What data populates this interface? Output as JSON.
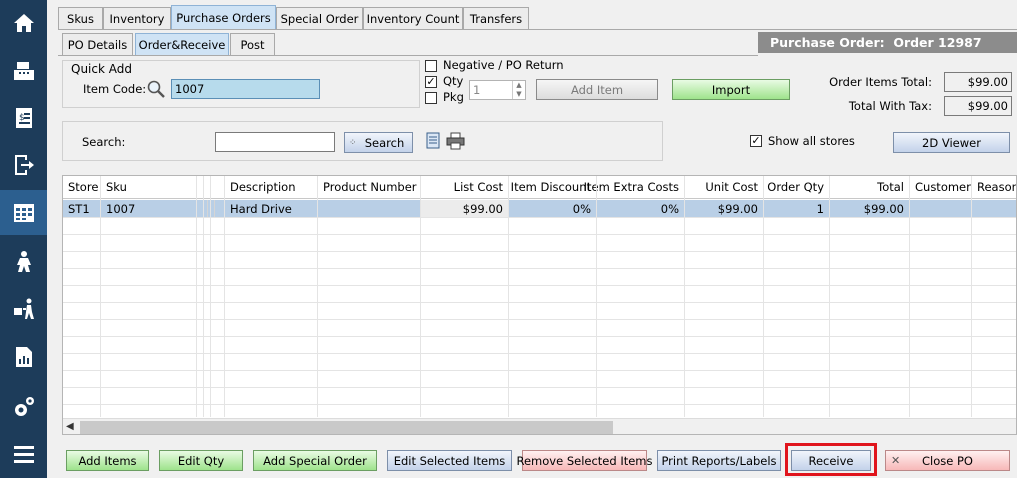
{
  "nav": {
    "icons": [
      "home-icon",
      "register-icon",
      "receipt-icon",
      "exit-icon",
      "inventory-icon",
      "customer-icon",
      "delivery-icon",
      "reports-icon",
      "settings-icon",
      "menu-icon"
    ]
  },
  "tabs": [
    "Skus",
    "Inventory",
    "Purchase Orders",
    "Special Order",
    "Inventory Count",
    "Transfers"
  ],
  "subtabs": [
    "PO Details",
    "Order&Receive",
    "Post"
  ],
  "po_header": "Purchase Order:  Order 12987",
  "quick_add": {
    "title": "Quick Add",
    "item_code_label": "Item Code:",
    "item_code_value": "1007"
  },
  "options": {
    "negative_label": "Negative / PO Return",
    "qty_label": "Qty",
    "pkg_label": "Pkg",
    "qty_value": "1",
    "negative_checked": false,
    "qty_checked": true,
    "pkg_checked": false
  },
  "buttons": {
    "add_item": "Add Item",
    "import": "Import",
    "search": "Search",
    "viewer": "2D Viewer"
  },
  "totals": {
    "order_items_label": "Order Items Total:",
    "order_items_value": "$99.00",
    "with_tax_label": "Total With Tax:",
    "with_tax_value": "$99.00"
  },
  "search": {
    "label": "Search:",
    "value": ""
  },
  "show_all_stores": {
    "label": "Show all stores",
    "checked": true
  },
  "table": {
    "columns": [
      "Store",
      "Sku",
      "",
      "",
      "",
      "Description",
      "Product Number",
      "List Cost",
      "Item Discount",
      "Item Extra Costs",
      "Unit Cost",
      "Order Qty",
      "Total",
      "Customer",
      "Reason"
    ],
    "rows": [
      [
        "ST1",
        "1007",
        "",
        "",
        "",
        "Hard Drive",
        "",
        "$99.00",
        "0%",
        "0%",
        "$99.00",
        "1",
        "$99.00",
        "",
        ""
      ]
    ]
  },
  "bottom_buttons": [
    "Add Items",
    "Edit Qty",
    "Add Special Order",
    "Edit Selected Items",
    "Remove Selected Items",
    "Print Reports/Labels",
    "Receive",
    "Close PO"
  ],
  "colors": {
    "nav_bg": "#1d3c5a",
    "nav_active": "#2c5f8f",
    "selected_row": "#b9cfe6",
    "highlight": "#e0141c"
  }
}
